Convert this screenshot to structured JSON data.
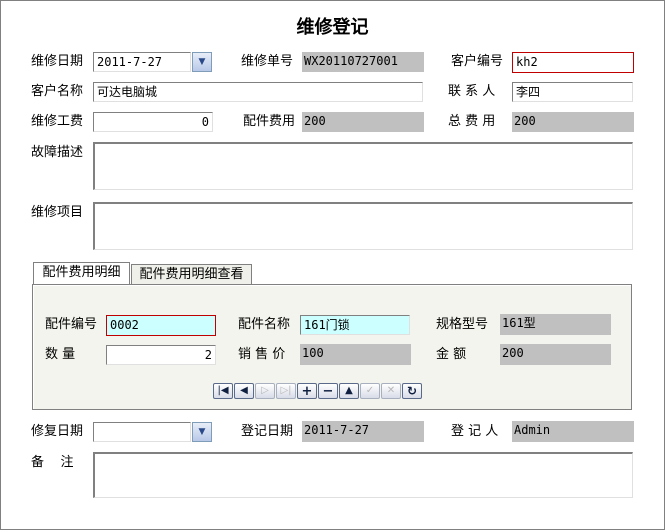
{
  "title": "维修登记",
  "fields": {
    "repair_date_label": "维修日期",
    "repair_date_value": "2011-7-27",
    "order_no_label": "维修单号",
    "order_no_value": "WX20110727001",
    "customer_no_label": "客户编号",
    "customer_no_value": "kh2",
    "customer_name_label": "客户名称",
    "customer_name_value": "可达电脑城",
    "contact_label": "联 系 人",
    "contact_value": "李四",
    "labor_fee_label": "维修工费",
    "labor_fee_value": "0",
    "parts_fee_label": "配件费用",
    "parts_fee_value": "200",
    "total_fee_label": "总 费 用",
    "total_fee_value": "200",
    "fault_desc_label": "故障描述",
    "repair_items_label": "维修项目",
    "fixed_date_label": "修复日期",
    "fixed_date_value": "",
    "register_date_label": "登记日期",
    "register_date_value": "2011-7-27",
    "registrar_label": "登 记 人",
    "registrar_value": "Admin",
    "remarks_label": "备    注"
  },
  "tabs": [
    {
      "label": "配件费用明细",
      "active": true
    },
    {
      "label": "配件费用明细查看",
      "active": false
    }
  ],
  "detail": {
    "part_no_label": "配件编号",
    "part_no_value": "0002",
    "part_name_label": "配件名称",
    "part_name_value": "161门锁",
    "spec_label": "规格型号",
    "spec_value": "161型",
    "qty_label": "数    量",
    "qty_value": "2",
    "price_label": "销 售 价",
    "price_value": "100",
    "amount_label": "金    额",
    "amount_value": "200"
  },
  "navigator": {
    "first": "|◀",
    "prior": "◀",
    "next": "▷",
    "last": "▷|",
    "insert": "+",
    "delete": "−",
    "edit": "▲",
    "post": "✓",
    "cancel": "✕",
    "refresh": "↻"
  },
  "colors": {
    "readonly": "#c0c0c0",
    "highlight": "#ccffff",
    "required_border": "#c00000"
  }
}
